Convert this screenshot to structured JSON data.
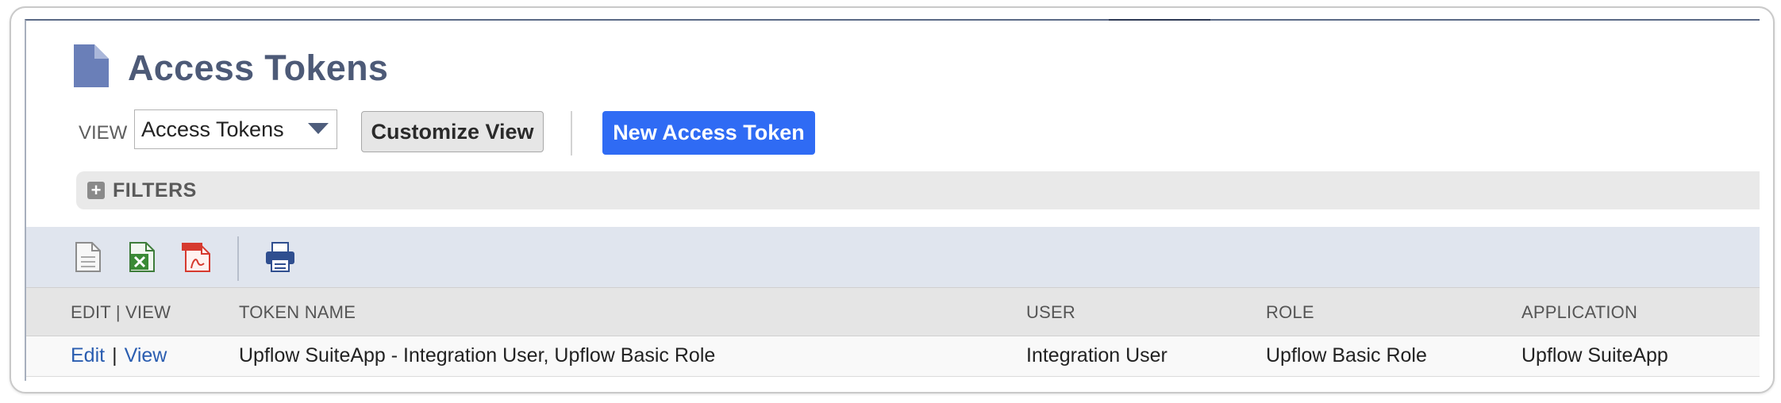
{
  "header": {
    "title": "Access Tokens",
    "page_icon": "document-icon"
  },
  "view": {
    "label": "VIEW",
    "selected": "Access Tokens"
  },
  "buttons": {
    "customize": "Customize View",
    "new_token": "New Access Token"
  },
  "filters": {
    "label": "FILTERS",
    "icon": "plus-icon"
  },
  "toolbar": {
    "icons": [
      "export-csv-icon",
      "export-excel-icon",
      "export-pdf-icon",
      "print-icon"
    ]
  },
  "table": {
    "columns": [
      "EDIT | VIEW",
      "TOKEN NAME",
      "USER",
      "ROLE",
      "APPLICATION"
    ],
    "rows": [
      {
        "edit": "Edit",
        "view": "View",
        "token_name": "Upflow SuiteApp - Integration User, Upflow Basic Role",
        "user": "Integration User",
        "role": "Upflow Basic Role",
        "application": "Upflow SuiteApp"
      }
    ]
  },
  "colors": {
    "title": "#4d5a77",
    "primary_button": "#2f6bf4",
    "link": "#2a5db0",
    "toolbar_bg": "#e0e5ee"
  }
}
